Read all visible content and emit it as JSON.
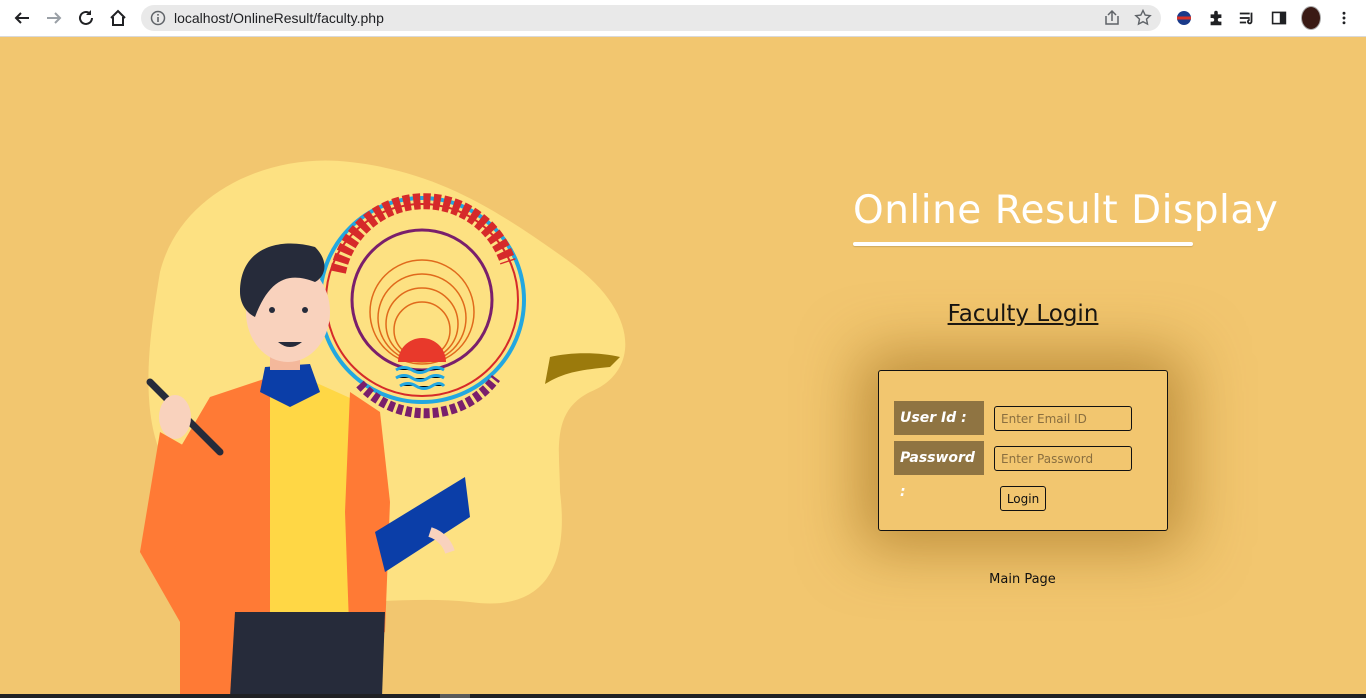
{
  "browser": {
    "url": "localhost/OnlineResult/faculty.php"
  },
  "icons": {
    "back": "arrow-left-icon",
    "forward": "arrow-right-icon",
    "reload": "reload-icon",
    "home": "home-icon",
    "site_info": "info-icon",
    "share": "share-icon",
    "bookmark": "star-icon",
    "extensions": "puzzle-icon",
    "reading_list": "playlist-icon",
    "side_panel": "side-panel-icon",
    "menu": "kebab-menu-icon"
  },
  "page": {
    "title": "Online Result Display",
    "subtitle": "Faculty Login",
    "form": {
      "user_label": "User Id :",
      "user_placeholder": "Enter Email ID",
      "password_label": "Password :",
      "password_placeholder": "Enter Password",
      "submit_label": "Login"
    },
    "main_link": "Main Page",
    "colors": {
      "background": "#f2c66f",
      "label_bg": "#8f7442",
      "title_color": "#ffffff"
    }
  }
}
